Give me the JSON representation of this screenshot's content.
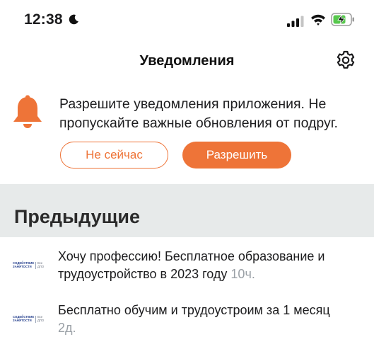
{
  "status_bar": {
    "time": "12:38"
  },
  "nav": {
    "title": "Уведомления"
  },
  "prompt": {
    "text": "Разрешите уведомления приложения. Не пропускайте важные обновления от подруг.",
    "later_label": "Не сейчас",
    "allow_label": "Разрешить"
  },
  "section": {
    "title": "Предыдущие"
  },
  "notifications": [
    {
      "logo_left": "СОДЕЙСТВИЕ ЗАНЯТОСТИ",
      "logo_right": "Все ДПО",
      "text": "Хочу профессию! Бесплатное образование и трудоустройство в 2023 году",
      "time": "10ч."
    },
    {
      "logo_left": "СОДЕЙСТВИЕ ЗАНЯТОСТИ",
      "logo_right": "Все ДПО",
      "text": "Бесплатно обучим и трудоустроим за 1 месяц",
      "time": "2д."
    }
  ],
  "colors": {
    "accent": "#ee7438",
    "section_bg": "#e7eaea",
    "muted_text": "#9aa0a6"
  },
  "icons": {
    "moon": "moon-icon",
    "signal": "cellular-signal-icon",
    "wifi": "wifi-icon",
    "battery": "battery-charging-icon",
    "settings": "gear-icon",
    "bell": "bell-icon"
  }
}
